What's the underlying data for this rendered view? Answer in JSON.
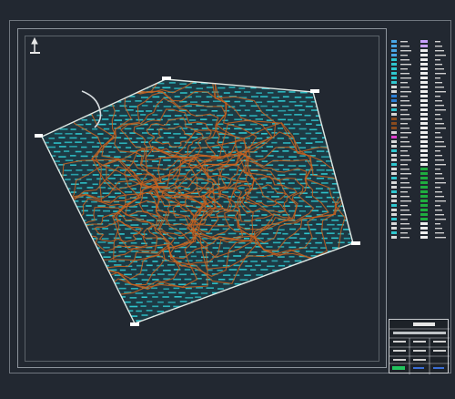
{
  "drawing": {
    "north_arrow_icon": "north-arrow-icon",
    "boundary_color": "#dfe8e4",
    "contour_color": "#c8621f",
    "label_color": "#2fc7cf",
    "background_color": "#222831"
  },
  "legend": {
    "swatches": [
      "#49a7e6",
      "#2fc7cf",
      "#d6d6d6",
      "#8a4b1e",
      "#e240d0",
      "#1fae3f",
      "#2b7fd6"
    ]
  },
  "title_block": {
    "accent_green": "#22c55e",
    "accent_blue": "#3b6fd6"
  }
}
